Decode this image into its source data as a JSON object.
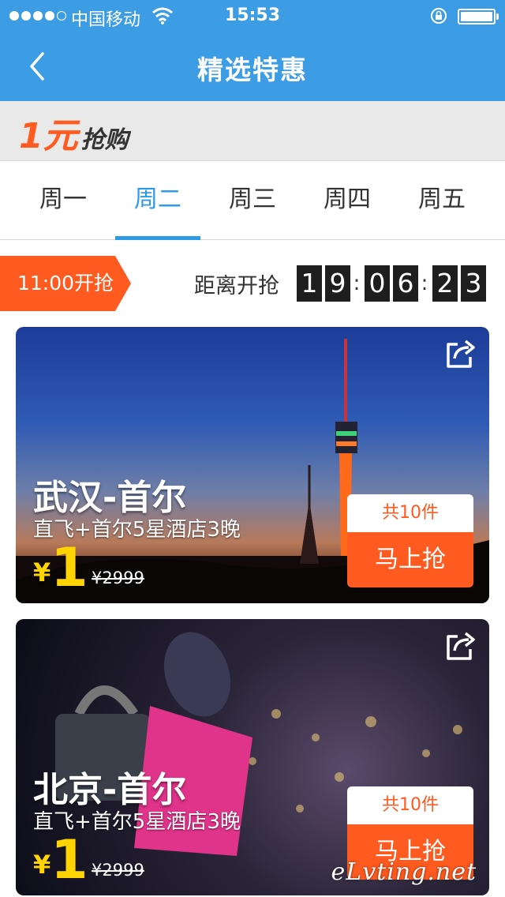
{
  "status_bar": {
    "carrier": "中国移动",
    "time": "15:53"
  },
  "nav": {
    "title": "精选特惠"
  },
  "banner": {
    "promo_big": "1元",
    "promo_small": "抢购"
  },
  "tabs": [
    {
      "label": "周一"
    },
    {
      "label": "周二",
      "active": true
    },
    {
      "label": "周三"
    },
    {
      "label": "周四"
    },
    {
      "label": "周五"
    }
  ],
  "countdown": {
    "start_label": "11:00开抢",
    "label": "距离开抢",
    "digits": [
      "1",
      "9",
      "0",
      "6",
      "2",
      "3"
    ],
    "separator": ":"
  },
  "deals": [
    {
      "route": "武汉-首尔",
      "description": "直飞+首尔5星酒店3晚",
      "currency": "¥",
      "price": "1",
      "original_price": "¥2999",
      "count": "共10件",
      "button": "马上抢"
    },
    {
      "route": "北京-首尔",
      "description": "直飞+首尔5星酒店3晚",
      "currency": "¥",
      "price": "1",
      "original_price": "¥2999",
      "count": "共10件",
      "button": "马上抢"
    }
  ],
  "watermark": "eLvting.net",
  "colors": {
    "nav_blue": "#3c9ce4",
    "accent_orange": "#ff5a1f",
    "tab_active": "#2d9be5",
    "price_yellow": "#ffd400"
  }
}
